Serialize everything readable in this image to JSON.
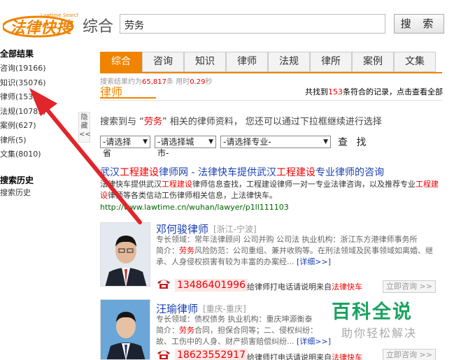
{
  "header": {
    "logo_text": "法律快搜",
    "logo_sub": "Lawtime Search",
    "category_word": "综合",
    "search_value": "劳务",
    "search_button": "搜 索"
  },
  "sidebar": {
    "title": "全部结果",
    "items": [
      {
        "label": "咨询(19166)"
      },
      {
        "label": "知识(35076)"
      },
      {
        "label": "律师(153)"
      },
      {
        "label": "法规(10785)"
      },
      {
        "label": "案例(627)"
      },
      {
        "label": "律所(5)"
      },
      {
        "label": "文集(8010)"
      }
    ],
    "history_title": "搜索历史",
    "history_item": "搜索历史"
  },
  "hide_tab": {
    "line1": "隐",
    "line2": "藏",
    "line3": "<<"
  },
  "tabs": [
    {
      "label": "综合",
      "active": true
    },
    {
      "label": "咨询"
    },
    {
      "label": "知识"
    },
    {
      "label": "律师"
    },
    {
      "label": "法规"
    },
    {
      "label": "律所"
    },
    {
      "label": "案例"
    },
    {
      "label": "文集"
    }
  ],
  "stats": {
    "prefix": "搜索结果约为",
    "count": "65,817",
    "mid": "条 用时",
    "time": "0.29",
    "suffix": "秒"
  },
  "section_title": "律师",
  "found": {
    "prefix": "共找到",
    "count": "153",
    "suffix": "条符合的记录，点击查看全部"
  },
  "intro": {
    "prefix": "搜索到与 “",
    "keyword": "劳务",
    "suffix": "” 相关的律师资料， 您还可以通过下拉框继续进行选择"
  },
  "selects": {
    "province": "-请选择省",
    "city": "-请选择城市-",
    "specialty": "-请选择专业-",
    "query_button": "查 找"
  },
  "result": {
    "title_a": "武汉",
    "title_hl1": "工程建设",
    "title_b": "律师网 - 法律快车提供武汉",
    "title_hl2": "工程建设",
    "title_c": "专业律师的咨询",
    "desc_a": "法律快车提供武汉",
    "desc_hl1": "工程建设",
    "desc_b": "律师信息查找，工程建设律师一对一专业法律咨询，以及推荐专业",
    "desc_hl2": "工程建设",
    "desc_c": "律师等各类信动工伤律师相关信息，上法律快车。",
    "url": "http://www.lawtime.cn/wuhan/lawyer/p1ll111103"
  },
  "lawyers": [
    {
      "name": "邓何骏律师",
      "location": "[浙江-宁波]",
      "fields": "专长领域：常年法律顾问  公司并购  公司法  执业机构：浙江东方港律师事务所",
      "intro_prefix": "简介：",
      "intro_hl": "劳务",
      "intro_rest": "风险防范：公司重组、兼并收购等。在刑法领域及民事领域如离婚、继承、人身侵权损害有较为丰富的办案经...",
      "more": "[详细>>]",
      "phone": "13486401996",
      "call_note_a": "给律师打电话请说明来自",
      "call_note_hl": "法律快车",
      "consult": "立即咨询 >>"
    },
    {
      "name": "汪瑜律师",
      "location": "[重庆-重庆]",
      "fields": "专长领域：债权债务  执业机构：重庆坤源衡泰",
      "intro_prefix": "简介：",
      "intro_hl": "劳务",
      "intro_rest": "合同，担保合同等；二、侵权纠纷：",
      "intro_line2": "故、工伤中的人身、财产损害赔偿纠纷...",
      "more": "[详细>>]",
      "phone": "18623552917",
      "call_note_a": "给律师打电话请说明来自",
      "call_note_hl": "法律快车",
      "consult": "立即咨询 >>"
    }
  ],
  "watermark": {
    "big": "百科全说",
    "small": "助你轻松解决"
  },
  "colors": {
    "accent": "#f08300",
    "link": "#1a3fb0",
    "highlight": "#e00000",
    "watermark": "#1aa260",
    "arrow": "#e0262b"
  }
}
